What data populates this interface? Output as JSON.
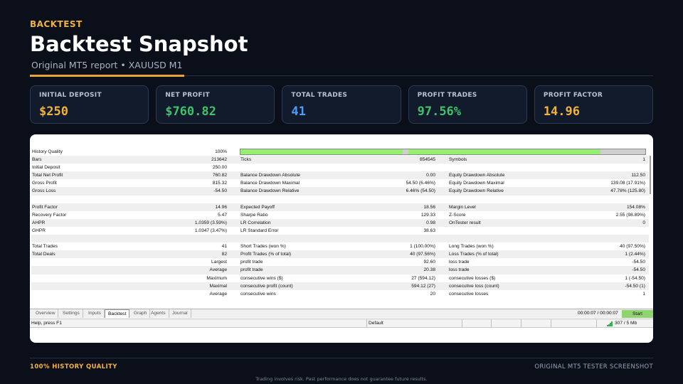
{
  "header": {
    "eyebrow": "BACKTEST",
    "title": "Backtest Snapshot",
    "subtitle": "Original MT5 report • XAUUSD M1"
  },
  "cards": [
    {
      "label": "INITIAL DEPOSIT",
      "value": "$250",
      "color": "#f2b33d"
    },
    {
      "label": "NET PROFIT",
      "value": "$760.82",
      "color": "#3fc26a"
    },
    {
      "label": "TOTAL TRADES",
      "value": "41",
      "color": "#4a9eff"
    },
    {
      "label": "PROFIT TRADES",
      "value": "97.56%",
      "color": "#3fc26a"
    },
    {
      "label": "PROFIT FACTOR",
      "value": "14.96",
      "color": "#f2b33d"
    }
  ],
  "report": {
    "history_quality": {
      "label": "History Quality",
      "value": "100%",
      "fill_fraction": 1.0,
      "bar_color": "#97ef72"
    },
    "rows": [
      [
        "Bars",
        "213642",
        "Ticks",
        "854545",
        "Symbols",
        "1"
      ],
      [
        "Initial Deposit",
        "250.00",
        "",
        "",
        "",
        ""
      ],
      [
        "Total Net Profit",
        "760.82",
        "Balance Drawdown Absolute",
        "0.00",
        "Equity Drawdown Absolute",
        "112.50"
      ],
      [
        "Gross Profit",
        "815.32",
        "Balance Drawdown Maximal",
        "54.50 (6.46%)",
        "Equity Drawdown Maximal",
        "139.08 (17.91%)"
      ],
      [
        "Gross Loss",
        "-54.50",
        "Balance Drawdown Relative",
        "6.46% (54.50)",
        "Equity Drawdown Relative",
        "47.78% (125.80)"
      ],
      [
        "",
        "",
        "",
        "",
        "",
        ""
      ],
      [
        "Profit Factor",
        "14.96",
        "Expected Payoff",
        "18.56",
        "Margin Level",
        "154.08%"
      ],
      [
        "Recovery Factor",
        "5.47",
        "Sharpe Ratio",
        "129.33",
        "Z-Score",
        "2.55 (98.89%)"
      ],
      [
        "AHPR",
        "1.0359 (3.59%)",
        "LR Correlation",
        "0.98",
        "OnTester result",
        "0"
      ],
      [
        "GHPR",
        "1.0347 (3.47%)",
        "LR Standard Error",
        "38.63",
        "",
        ""
      ],
      [
        "",
        "",
        "",
        "",
        "",
        ""
      ],
      [
        "Total Trades",
        "41",
        "Short Trades (won %)",
        "1 (100.00%)",
        "Long Trades (won %)",
        "40 (97.50%)"
      ],
      [
        "Total Deals",
        "82",
        "Profit Trades (% of total)",
        "40 (97.56%)",
        "Loss Trades (% of total)",
        "1 (2.44%)"
      ],
      [
        "",
        "Largest",
        "profit trade",
        "92.60",
        "loss trade",
        "-54.50"
      ],
      [
        "",
        "Average",
        "profit trade",
        "20.38",
        "loss trade",
        "-54.50"
      ],
      [
        "",
        "Maximum",
        "consecutive wins ($)",
        "27 (594.12)",
        "consecutive losses ($)",
        "1 (-54.50)"
      ],
      [
        "",
        "Maximal",
        "consecutive profit (count)",
        "594.12 (27)",
        "consecutive loss (count)",
        "-54.50 (1)"
      ],
      [
        "",
        "Average",
        "consecutive wins",
        "20",
        "consecutive losses",
        "1"
      ]
    ]
  },
  "tabs": [
    "Overview",
    "Settings",
    "Inputs",
    "Backtest",
    "Graph",
    "Agents",
    "Journal"
  ],
  "active_tab": "Backtest",
  "tester": {
    "timer": "00:00:07 / 00:00:07",
    "start_label": "Start",
    "status_help": "Help, press F1",
    "status_profile": "Default",
    "status_traffic": "307 / 5 Mb"
  },
  "footer": {
    "left": "100% HISTORY QUALITY",
    "right": "ORIGINAL MT5 TESTER SCREENSHOT",
    "disclaimer": "Trading involves risk. Past performance does not guarantee future results."
  }
}
